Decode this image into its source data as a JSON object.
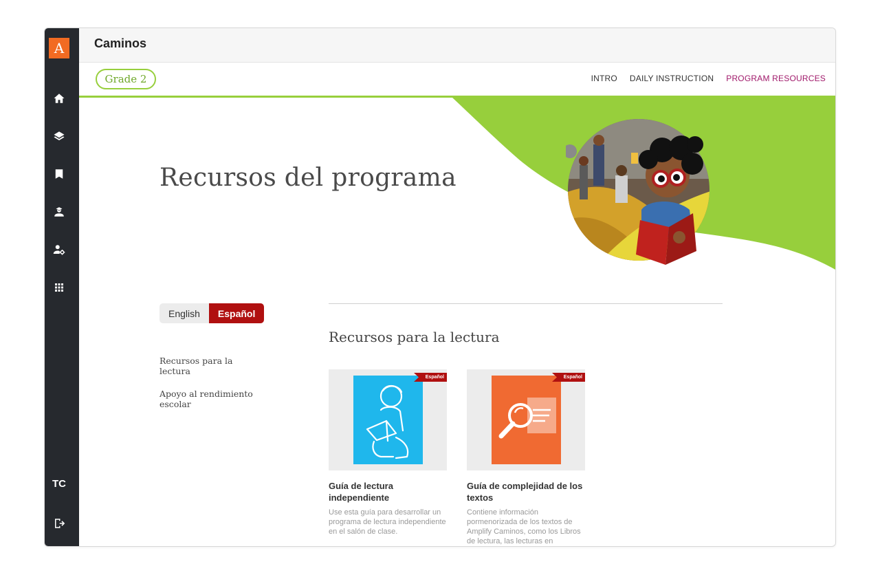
{
  "app": {
    "logo_letter": "A",
    "title": "Caminos",
    "user_initials": "TC"
  },
  "rail": {
    "icons": [
      "home-icon",
      "layers-icon",
      "bookmark-icon",
      "teacher-icon",
      "user-settings-icon",
      "apps-grid-icon",
      "logout-icon"
    ]
  },
  "subnav": {
    "grade": "Grade 2",
    "links": [
      "INTRO",
      "DAILY INSTRUCTION",
      "PROGRAM RESOURCES"
    ],
    "active_link": "PROGRAM RESOURCES"
  },
  "hero": {
    "title": "Recursos del programa"
  },
  "language": {
    "english": "English",
    "spanish": "Español",
    "selected": "Español"
  },
  "side_nav": {
    "items": [
      "Recursos para la lectura",
      "Apoyo al rendimiento escolar"
    ]
  },
  "section": {
    "title": "Recursos para la lectura"
  },
  "cards": [
    {
      "badge": "Español",
      "title": "Guía de lectura independiente",
      "description": "Use esta guía para desarrollar un programa de lectura independiente en el salón de clase."
    },
    {
      "badge": "Español",
      "title": "Guía de complejidad de los textos",
      "description": "Contiene información pormenorizada de los textos de Amplify Caminos, como los Libros de lectura, las lecturas en"
    }
  ],
  "colors": {
    "brand_orange": "#f26b22",
    "accent_green": "#97cf3c",
    "active_link": "#a0186a",
    "spanish_red": "#b01010",
    "rail_dark": "#26292e"
  }
}
